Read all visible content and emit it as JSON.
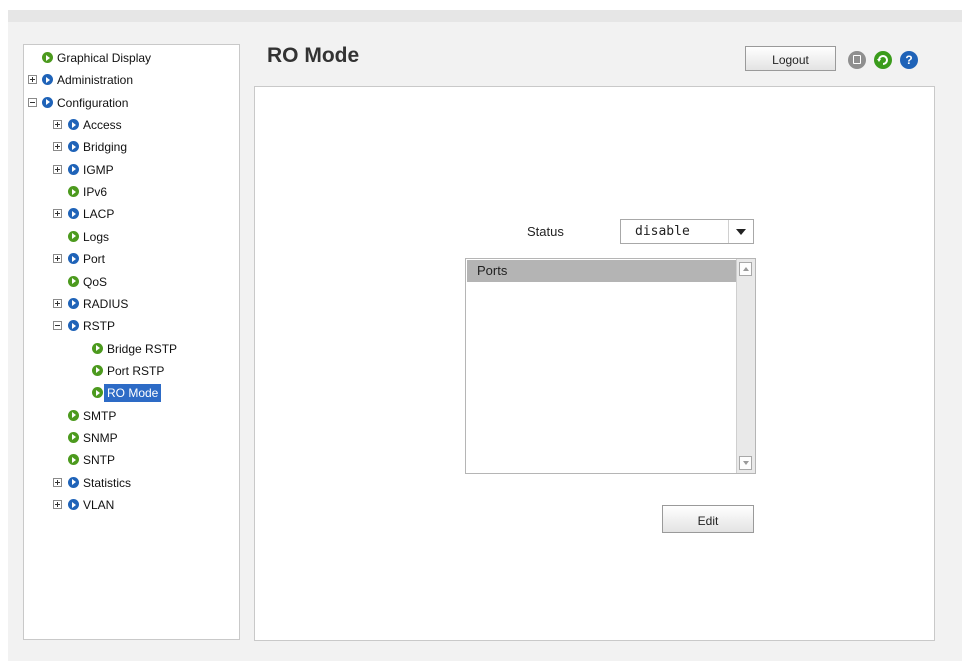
{
  "nav": {
    "items": [
      {
        "label": "Graphical Display",
        "level": 0,
        "expander": "none",
        "bullet": "green"
      },
      {
        "label": "Administration",
        "level": 0,
        "expander": "plus",
        "bullet": "blue"
      },
      {
        "label": "Configuration",
        "level": 0,
        "expander": "minus",
        "bullet": "blue"
      },
      {
        "label": "Access",
        "level": 1,
        "expander": "plus",
        "bullet": "blue"
      },
      {
        "label": "Bridging",
        "level": 1,
        "expander": "plus",
        "bullet": "blue"
      },
      {
        "label": "IGMP",
        "level": 1,
        "expander": "plus",
        "bullet": "blue"
      },
      {
        "label": "IPv6",
        "level": 1,
        "expander": "none",
        "bullet": "green"
      },
      {
        "label": "LACP",
        "level": 1,
        "expander": "plus",
        "bullet": "blue"
      },
      {
        "label": "Logs",
        "level": 1,
        "expander": "none",
        "bullet": "green"
      },
      {
        "label": "Port",
        "level": 1,
        "expander": "plus",
        "bullet": "blue"
      },
      {
        "label": "QoS",
        "level": 1,
        "expander": "none",
        "bullet": "green"
      },
      {
        "label": "RADIUS",
        "level": 1,
        "expander": "plus",
        "bullet": "blue"
      },
      {
        "label": "RSTP",
        "level": 1,
        "expander": "minus",
        "bullet": "blue"
      },
      {
        "label": "Bridge RSTP",
        "level": 2,
        "expander": "none",
        "bullet": "green"
      },
      {
        "label": "Port RSTP",
        "level": 2,
        "expander": "none",
        "bullet": "green"
      },
      {
        "label": "RO Mode",
        "level": 2,
        "expander": "none",
        "bullet": "green",
        "selected": true
      },
      {
        "label": "SMTP",
        "level": 1,
        "expander": "none",
        "bullet": "green"
      },
      {
        "label": "SNMP",
        "level": 1,
        "expander": "none",
        "bullet": "green"
      },
      {
        "label": "SNTP",
        "level": 1,
        "expander": "none",
        "bullet": "green"
      },
      {
        "label": "Statistics",
        "level": 1,
        "expander": "plus",
        "bullet": "blue"
      },
      {
        "label": "VLAN",
        "level": 1,
        "expander": "plus",
        "bullet": "blue"
      }
    ]
  },
  "header": {
    "title": "RO Mode",
    "logout_label": "Logout",
    "icons": {
      "save": "save-icon",
      "refresh": "refresh-icon",
      "help": "help-icon",
      "help_glyph": "?"
    }
  },
  "form": {
    "status_label": "Status",
    "status_value": "disable",
    "ports_header": "Ports",
    "edit_label": "Edit"
  },
  "colors": {
    "selected_bg": "#2d6bc6",
    "bullet_green": "#4c9a1e",
    "bullet_blue": "#1f63b8"
  }
}
